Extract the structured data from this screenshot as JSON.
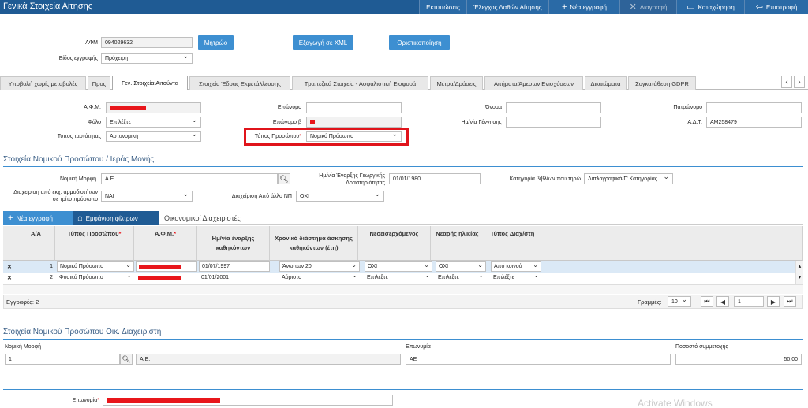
{
  "topbar": {
    "title": "Γενικά Στοιχεία Αίτησης",
    "buttons": {
      "prints": "Εκτυπώσεις",
      "errors": "Έλεγχος Λαθών Αίτησης",
      "new": "Νέα εγγραφή",
      "delete": "Διαγραφή",
      "save": "Καταχώρηση",
      "back": "Επιστροφή"
    }
  },
  "header": {
    "afm_label": "ΑΦΜ",
    "afm_value": "094029632",
    "type_label": "Είδος εγγραφής",
    "type_value": "Πρόχειρη",
    "registry_btn": "Μητρώο",
    "export_btn": "Εξαγωγή σε XML",
    "finalize_btn": "Οριστικοποίηση"
  },
  "tabs": [
    "Υποβολή χωρίς μεταβολές",
    "Προς",
    "Γεν. Στοιχεία Αιτούντα",
    "Στοιχεία Έδρας Εκμετάλλευσης",
    "Τραπεζικά Στοιχεία - Ασφαλιστική Εισφορά",
    "Μέτρα/Δράσεις",
    "Αιτήματα Άμεσων Ενισχύσεων",
    "Δικαιώματα",
    "Συγκατάθεση GDPR"
  ],
  "applicant": {
    "afm_label": "Α.Φ.Μ.",
    "sex_label": "Φύλο",
    "sex_value": "Επιλέξτε",
    "idtype_label": "Τύπος ταυτότητας",
    "idtype_value": "Αστυνομική",
    "surname_label": "Επώνυμο",
    "surname2_label": "Επώνυμο β",
    "persontype_label": "Τύπος Προσώπου",
    "persontype_value": "Νομικό Πρόσωπο",
    "name_label": "Όνομα",
    "birth_label": "Ημ/νία Γέννησης",
    "father_label": "Πατρώνυμο",
    "adt_label": "Α.Δ.Τ.",
    "adt_value": "ΑΜ258479"
  },
  "legal": {
    "section_title": "Στοιχεία Νομικού Προσώπου / Ιεράς Μονής",
    "form_label": "Νομική Μορφή",
    "form_value": "Α.Ε.",
    "start_label_1": "Ημ/νία Έναρξης Γεωργικής",
    "start_label_2": "Δραστηριότητας",
    "start_value": "01/01/1980",
    "books_label": "Κατηγορία βιβλίων που τηρώ",
    "books_value": "Διπλογραφικά/Γ' Κατηγορίας",
    "mgmt_label_1": "Διαχείριση από εκχ. αρμοδιοτήτων",
    "mgmt_label_2": "σε τρίτο πρόσωπο",
    "mgmt_value": "ΝΑΙ",
    "other_label": "Διαχείριση Από άλλο ΝΠ",
    "other_value": "ΟΧΙ"
  },
  "grid": {
    "new_btn": "Νέα εγγραφή",
    "filter_btn": "Εμφάνιση φίλτρων",
    "tab_label": "Οικονομικοί Διαχειριστές",
    "headers": [
      "Α/Α",
      "Τύπος Προσώπου",
      "Α.Φ.Μ.",
      "Ημ/νία έναρξης καθηκόντων",
      "Χρονικό διάστημα άσκησης καθηκόντων (έτη)",
      "Νεοεισερχόμενος",
      "Νεαρής ηλικίας",
      "Τύπος Διαχ/στή"
    ],
    "rows": [
      {
        "num": "1",
        "type": "Νομικό Πρόσωπο",
        "date": "01/07/1997",
        "period": "Άνω των 20",
        "newcomer": "ΟΧΙ",
        "young": "ΟΧΙ",
        "mtype": "Από κοινού"
      },
      {
        "num": "2",
        "type": "Φυσικό Πρόσωπο",
        "date": "01/01/2001",
        "period": "Αόριστο",
        "newcomer": "Επιλέξτε",
        "young": "Επιλέξτε",
        "mtype": "Επιλέξτε"
      }
    ],
    "records_label": "Εγγραφές: 2",
    "rows_label": "Γραμμές:",
    "rows_value": "10",
    "page_value": "1"
  },
  "mgr": {
    "section_title": "Στοιχεία Νομικού Προσώπου Οικ. Διαχειριστή",
    "form_label": "Νομική Μορφή",
    "form_code": "1",
    "form_value": "Α.Ε.",
    "name_label": "Επωνυμία",
    "name_value": "ΑΕ",
    "pct_label": "Ποσοστό συμμετοχής",
    "pct_value": "50,00"
  },
  "bottom": {
    "name_label": "Επωνυμία"
  },
  "watermark": "Activate Windows"
}
